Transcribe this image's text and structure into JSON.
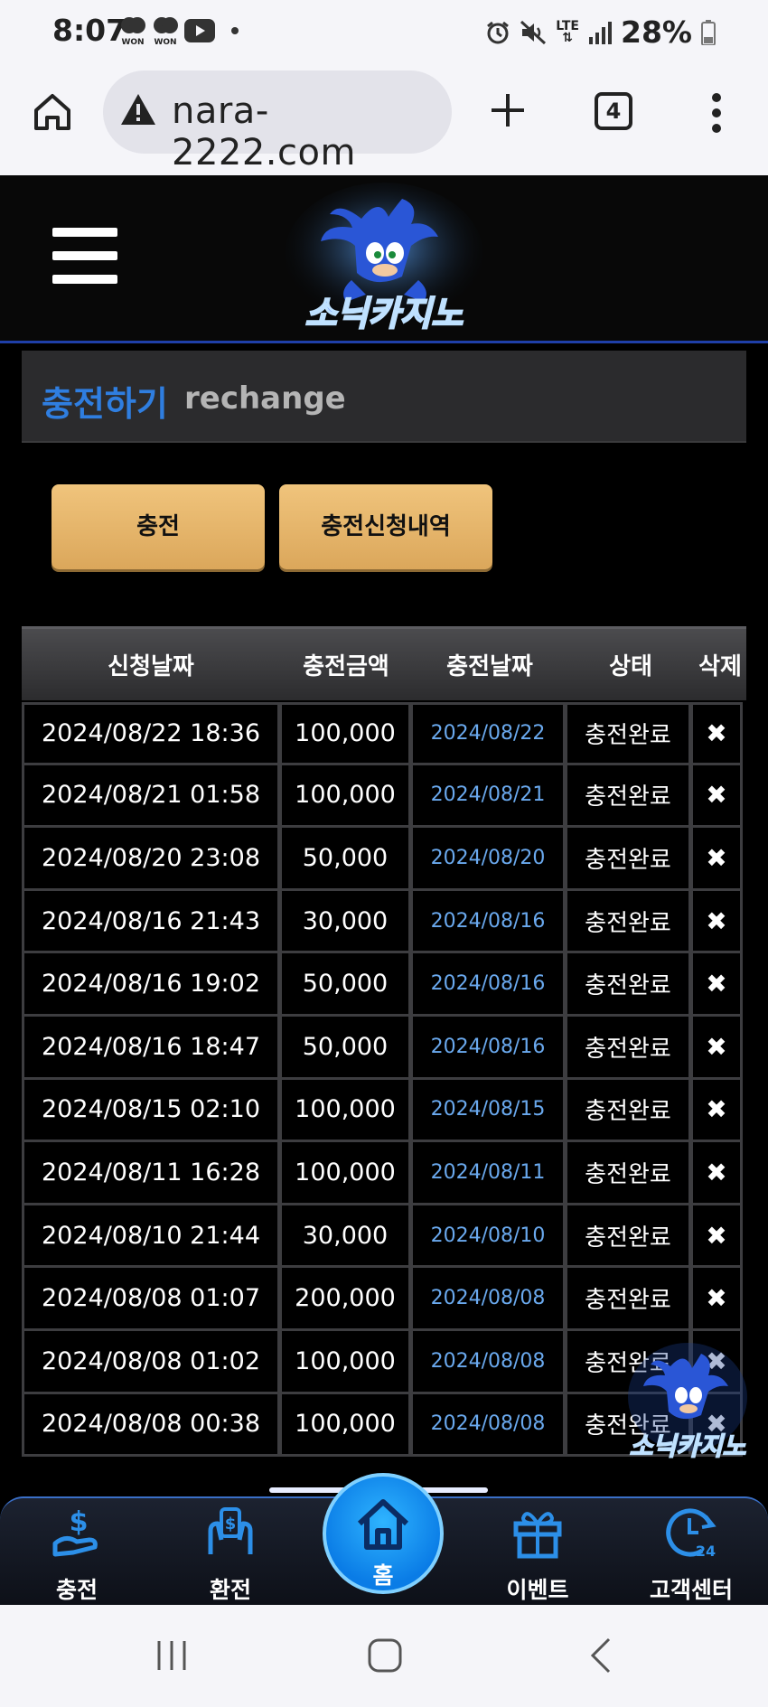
{
  "status_bar": {
    "time": "8:07",
    "notif_labels": [
      "WON",
      "WON"
    ],
    "lte": "LTE",
    "battery": "28%"
  },
  "browser": {
    "url": "nara-2222.com",
    "tab_count": "4"
  },
  "site": {
    "logo_text": "소닉카지노"
  },
  "page": {
    "title_ko": "충전하기",
    "title_en": "rechange"
  },
  "buttons": {
    "charge": "충전",
    "history": "충전신청내역"
  },
  "table": {
    "headers": [
      "신청날짜",
      "충전금액",
      "충전날짜",
      "상태",
      "삭제"
    ],
    "delete_symbol": "✖",
    "rows": [
      {
        "request_date": "2024/08/22 18:36",
        "amount": "100,000",
        "charge_date": "2024/08/22",
        "status": "충전완료"
      },
      {
        "request_date": "2024/08/21 01:58",
        "amount": "100,000",
        "charge_date": "2024/08/21",
        "status": "충전완료"
      },
      {
        "request_date": "2024/08/20 23:08",
        "amount": "50,000",
        "charge_date": "2024/08/20",
        "status": "충전완료"
      },
      {
        "request_date": "2024/08/16 21:43",
        "amount": "30,000",
        "charge_date": "2024/08/16",
        "status": "충전완료"
      },
      {
        "request_date": "2024/08/16 19:02",
        "amount": "50,000",
        "charge_date": "2024/08/16",
        "status": "충전완료"
      },
      {
        "request_date": "2024/08/16 18:47",
        "amount": "50,000",
        "charge_date": "2024/08/16",
        "status": "충전완료"
      },
      {
        "request_date": "2024/08/15 02:10",
        "amount": "100,000",
        "charge_date": "2024/08/15",
        "status": "충전완료"
      },
      {
        "request_date": "2024/08/11 16:28",
        "amount": "100,000",
        "charge_date": "2024/08/11",
        "status": "충전완료"
      },
      {
        "request_date": "2024/08/10 21:44",
        "amount": "30,000",
        "charge_date": "2024/08/10",
        "status": "충전완료"
      },
      {
        "request_date": "2024/08/08 01:07",
        "amount": "200,000",
        "charge_date": "2024/08/08",
        "status": "충전완료"
      },
      {
        "request_date": "2024/08/08 01:02",
        "amount": "100,000",
        "charge_date": "2024/08/08",
        "status": "충전완료"
      },
      {
        "request_date": "2024/08/08 00:38",
        "amount": "100,000",
        "charge_date": "2024/08/08",
        "status": "충전완료"
      }
    ]
  },
  "bottom_nav": {
    "charge": "충전",
    "exchange": "환전",
    "home": "홈",
    "event": "이벤트",
    "support": "고객센터",
    "support_badge": "24"
  },
  "colors": {
    "accent_blue": "#2f7ee0",
    "button_gold": "#e6b468",
    "date_blue": "#6aa9ee"
  }
}
